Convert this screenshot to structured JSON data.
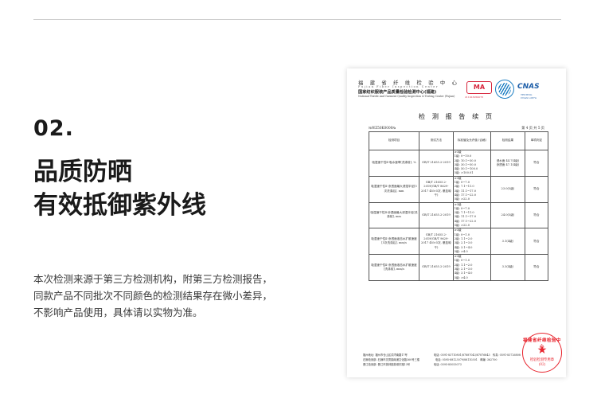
{
  "section": {
    "number": "02.",
    "title_line1": "品质防晒",
    "title_line2": "有效抵御紫外线",
    "desc_lines": [
      "本次检测来源于第三方检测机构，附第三方检测报告，",
      "同款产品不同批次不同颜色的检测结果存在微小差异，",
      "不影响产品使用，具体请以实物为准。"
    ]
  },
  "report": {
    "org_cn": "福 建 省 纤 维 检 验 中 心",
    "org_en": "Fujian Fiber Inspection Center",
    "center_cn": "国家纺织服装产品质量检验检测中心(福建)",
    "center_en": "National Textile And Garment Quality Inspection & Testing Center (Fujian)",
    "ma_logo": "MA",
    "ma_cert": "211913050078",
    "cnas_logo": "CNAS",
    "cnas_sub_1": "TESTING",
    "cnas_sub_2": "CNAS L2874",
    "page_title": "检 测 报 告 续 页",
    "report_no": "№WZ50K0000№",
    "page_info": "第 4 页 共 5 页",
    "table": {
      "headers": [
        "检测项目",
        "测试方法",
        "标准值及允许值 (合格)",
        "检测结果",
        "单项判定"
      ],
      "rows": [
        {
          "item": "吸湿速干性Ⅱ-吸水速率[洗涤前], %",
          "method": "GB/T 21655.2-2019",
          "req": [
            "≥3级",
            "1级: 0~10.0",
            "2级: 10.1~30.0",
            "3级: 30.1~50.0",
            "4级: 50.1~100.0",
            "5级: >100.01"
          ],
          "result": [
            "浸水面 44.7(4级)",
            "渗透面 47.1(4级)"
          ],
          "verdict": "符合"
        },
        {
          "item": "吸湿速干性Ⅱ-渗透面最大浸湿半径[5次洗涤后], mm",
          "method": "GB/T 21655.2-2019(GB/T 8629-2017 4N×5次, 悬挂晾干)",
          "req": [
            "≥3级",
            "1级: 0~7.0",
            "2级: 7.1~11.0",
            "3级: 11.1~17.0",
            "4级: 17.1~22.0",
            "5级: >22.0"
          ],
          "result": [
            "23.0(5级)"
          ],
          "verdict": "符合"
        },
        {
          "item": "吸湿速干性Ⅱ-渗透面最大浸湿半径[洗涤前], mm",
          "method": "GB/T 21655.2-2019",
          "req": [
            "≥3级",
            "1级: 0~7.0",
            "2级: 7.1~11.0",
            "3级: 11.1~17.0",
            "4级: 17.1~22.0",
            "5级: >22.0"
          ],
          "result": [
            "24.0(5级)"
          ],
          "verdict": "符合"
        },
        {
          "item": "吸湿速干性Ⅱ-渗透面液态水扩散速度[5次洗涤后], mm/s",
          "method": "GB/T 21655.2-2019(GB/T 9629-2017 4N×5次, 悬挂晾干)",
          "req": [
            "≥3级",
            "1级: 0~1.0",
            "2级: 1.1~2.0",
            "3级: 2.1~3.0",
            "4级: 3.1~4.0",
            "5级: >4.0"
          ],
          "result": [
            "3.1(4级)"
          ],
          "verdict": "符合"
        },
        {
          "item": "吸湿速干性Ⅱ-渗透面液态水扩散速度[洗涤前], mm/s",
          "method": "GB/T 21655.2-2019",
          "req": [
            "≥3级",
            "1级: 0~1.0",
            "2级: 1.1~2.0",
            "3级: 2.1~3.0",
            "4级: 3.1~4.0",
            "5级: >4.0"
          ],
          "result": [
            "3.3(4级)"
          ],
          "verdict": "符合"
        }
      ]
    },
    "footer_lines": [
      "福州地址: 福州市仓山区洪湾南路17号　　　　　　　　　　电话: 0591-83710801/87887043/87876843　传真: 0591-83726808",
      "石狮检测部: 石狮市灵秀镇南浦文化路360号三楼　　　　　　电话: 0595-88123079/88110301　邮编: 362700",
      "晋江检测部: 晋江市英林镇英墩东路13号　　　　　　　　　电话: 0595-85053073"
    ],
    "seal": {
      "arc_text": "福建省纤维检验中心",
      "star": "★",
      "mid_text": "检验检测专用章",
      "num": "(02)"
    }
  }
}
